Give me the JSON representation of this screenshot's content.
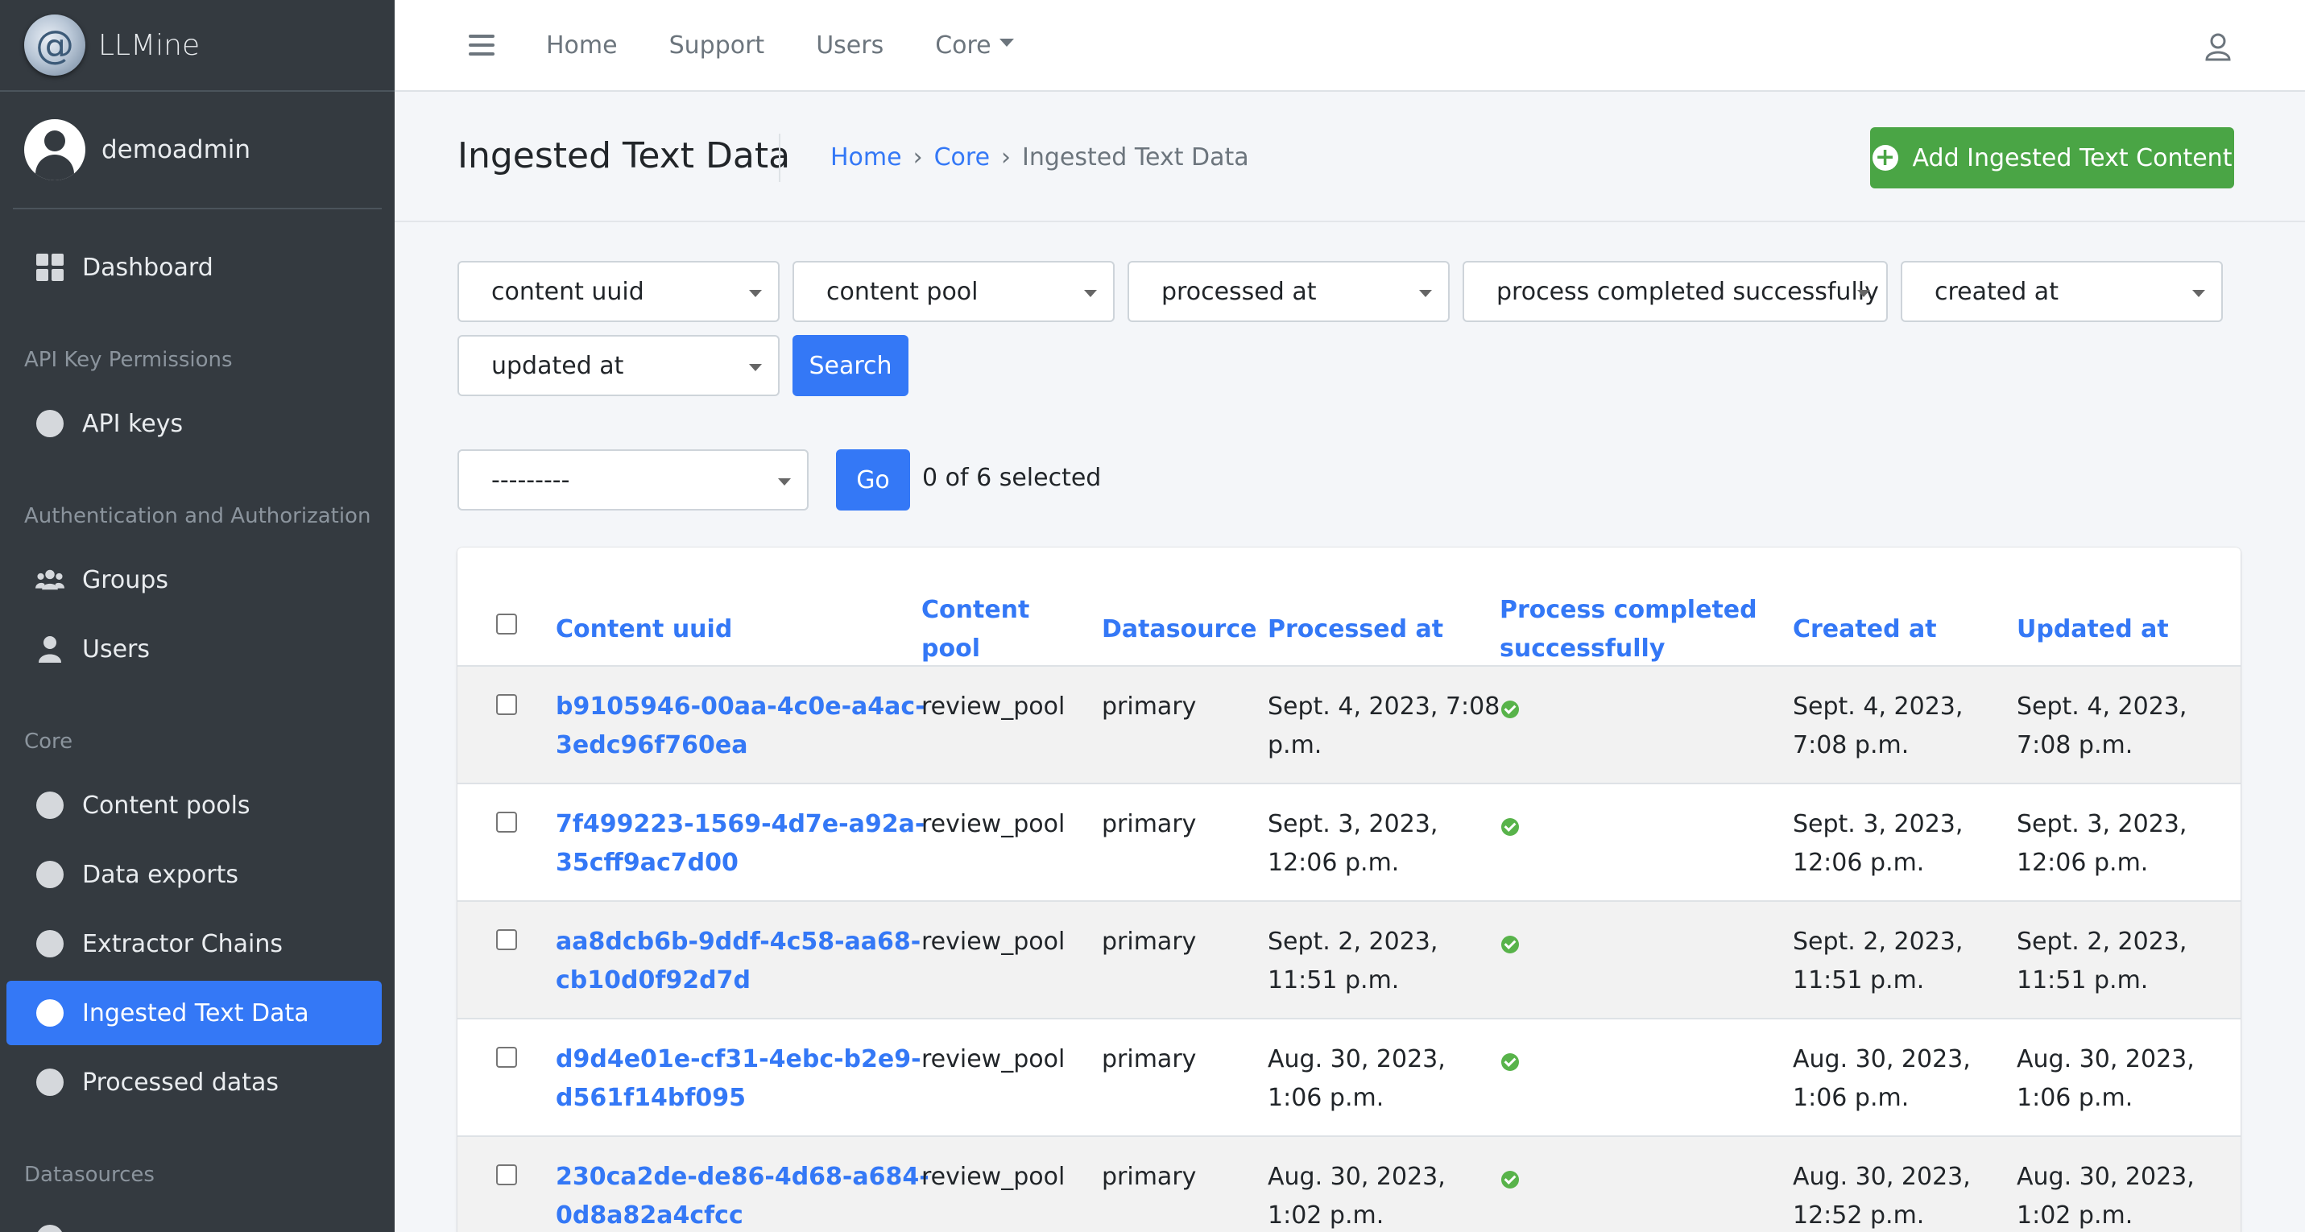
{
  "app": {
    "brand": "LLMine"
  },
  "user": {
    "name": "demoadmin"
  },
  "sidebar": {
    "dashboard": "Dashboard",
    "api_header": "API Key Permissions",
    "api_keys": "API keys",
    "auth_header": "Authentication and Authorization",
    "groups": "Groups",
    "users": "Users",
    "core_header": "Core",
    "content_pools": "Content pools",
    "data_exports": "Data exports",
    "extractor_chains": "Extractor Chains",
    "ingested_text_data": "Ingested Text Data",
    "processed_datas": "Processed datas",
    "datasources_header": "Datasources"
  },
  "topnav": {
    "home": "Home",
    "support": "Support",
    "users": "Users",
    "core": "Core"
  },
  "page": {
    "title": "Ingested Text Data",
    "breadcrumb": {
      "home": "Home",
      "core": "Core",
      "current": "Ingested Text Data",
      "separator": "›"
    },
    "add_button": "Add Ingested Text Content"
  },
  "filters": {
    "content_uuid": "content uuid",
    "content_pool": "content pool",
    "processed_at": "processed at",
    "process_completed": "process completed successfully",
    "created_at": "created at",
    "updated_at": "updated at",
    "search_button": "Search"
  },
  "actions": {
    "selected_action": "---------",
    "go_button": "Go",
    "selected_count": "0 of 6 selected"
  },
  "table": {
    "headers": {
      "content_uuid": "Content uuid",
      "content_pool_1": "Content",
      "content_pool_2": "pool",
      "datasource": "Datasource",
      "processed_at": "Processed at",
      "process_completed_1": "Process completed",
      "process_completed_2": "successfully",
      "created_at": "Created at",
      "updated_at": "Updated at"
    },
    "rows": [
      {
        "uuid_1": "b9105946-00aa-4c0e-a4ac-",
        "uuid_2": "3edc96f760ea",
        "pool": "review_pool",
        "datasource": "primary",
        "processed_1": "Sept. 4, 2023, 7:08",
        "processed_2": "p.m.",
        "created_1": "Sept. 4, 2023,",
        "created_2": "7:08 p.m.",
        "updated_1": "Sept. 4, 2023,",
        "updated_2": "7:08 p.m.",
        "completed": true
      },
      {
        "uuid_1": "7f499223-1569-4d7e-a92a-",
        "uuid_2": "35cff9ac7d00",
        "pool": "review_pool",
        "datasource": "primary",
        "processed_1": "Sept. 3, 2023,",
        "processed_2": "12:06 p.m.",
        "created_1": "Sept. 3, 2023,",
        "created_2": "12:06 p.m.",
        "updated_1": "Sept. 3, 2023,",
        "updated_2": "12:06 p.m.",
        "completed": true
      },
      {
        "uuid_1": "aa8dcb6b-9ddf-4c58-aa68-",
        "uuid_2": "cb10d0f92d7d",
        "pool": "review_pool",
        "datasource": "primary",
        "processed_1": "Sept. 2, 2023,",
        "processed_2": "11:51 p.m.",
        "created_1": "Sept. 2, 2023,",
        "created_2": "11:51 p.m.",
        "updated_1": "Sept. 2, 2023,",
        "updated_2": "11:51 p.m.",
        "completed": true
      },
      {
        "uuid_1": "d9d4e01e-cf31-4ebc-b2e9-",
        "uuid_2": "d561f14bf095",
        "pool": "review_pool",
        "datasource": "primary",
        "processed_1": "Aug. 30, 2023,",
        "processed_2": "1:06 p.m.",
        "created_1": "Aug. 30, 2023,",
        "created_2": "1:06 p.m.",
        "updated_1": "Aug. 30, 2023,",
        "updated_2": "1:06 p.m.",
        "completed": true
      },
      {
        "uuid_1": "230ca2de-de86-4d68-a684-",
        "uuid_2": "0d8a82a4cfcc",
        "pool": "review_pool",
        "datasource": "primary",
        "processed_1": "Aug. 30, 2023,",
        "processed_2": "1:02 p.m.",
        "created_1": "Aug. 30, 2023,",
        "created_2": "12:52 p.m.",
        "updated_1": "Aug. 30, 2023,",
        "updated_2": "1:02 p.m.",
        "completed": true
      }
    ]
  },
  "colors": {
    "primary": "#3478f6",
    "success": "#4aa545",
    "sidebar_bg": "#343a40"
  },
  "icons": {
    "brand": "spiral-logo-icon",
    "menu": "hamburger-icon",
    "dashboard": "grid-icon",
    "groups": "users-group-icon",
    "users": "user-icon",
    "add": "plus-circle-icon",
    "completed": "check-circle-icon",
    "profile": "user-outline-icon"
  }
}
